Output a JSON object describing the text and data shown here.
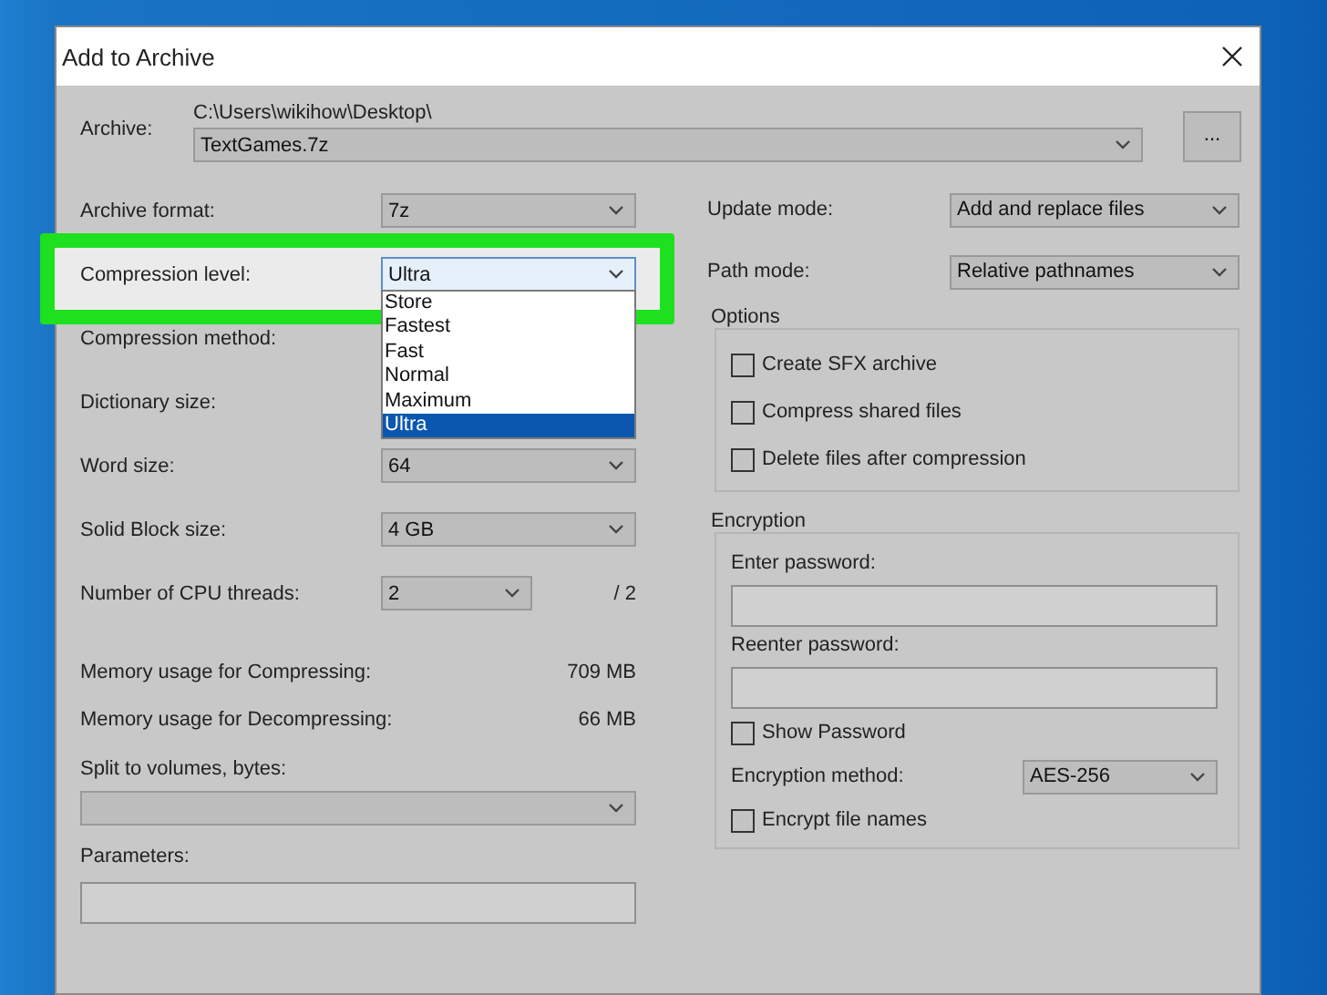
{
  "window": {
    "title": "Add to Archive"
  },
  "archive": {
    "label": "Archive:",
    "path": "C:\\Users\\wikihow\\Desktop\\",
    "value": "TextGames.7z",
    "browse_button": "..."
  },
  "left_rows": [
    {
      "kind": "combo",
      "label": "Archive format:",
      "value": "7z"
    },
    {
      "kind": "combo",
      "label": "Compression level:",
      "value": "Ultra",
      "highlighted": true,
      "expanded": true,
      "options": [
        {
          "label": "Store",
          "selected": false
        },
        {
          "label": "Fastest",
          "selected": false
        },
        {
          "label": "Fast",
          "selected": false
        },
        {
          "label": "Normal",
          "selected": false
        },
        {
          "label": "Maximum",
          "selected": false
        },
        {
          "label": "Ultra",
          "selected": true
        }
      ]
    },
    {
      "kind": "combo",
      "label": "Compression method:"
    },
    {
      "kind": "combo",
      "label": "Dictionary size:"
    },
    {
      "kind": "combo",
      "label": "Word size:",
      "value": "64"
    },
    {
      "kind": "combo",
      "label": "Solid Block size:",
      "value": "4 GB"
    },
    {
      "kind": "short_combo",
      "label": "Number of CPU threads:",
      "value": "2",
      "suffix": "/ 2"
    },
    {
      "kind": "reading",
      "label": "Memory usage for Compressing:",
      "value": "709 MB"
    },
    {
      "kind": "reading",
      "label": "Memory usage for Decompressing:",
      "value": "66 MB"
    },
    {
      "kind": "wide_combo",
      "label": "Split to volumes, bytes:"
    },
    {
      "kind": "wide_field",
      "label": "Parameters:"
    }
  ],
  "update_mode": {
    "label": "Update mode:",
    "value": "Add and replace files"
  },
  "path_mode": {
    "label": "Path mode:",
    "value": "Relative pathnames"
  },
  "options": {
    "title": "Options",
    "checkboxes": [
      {
        "label": "Create SFX archive",
        "checked": false
      },
      {
        "label": "Compress shared files",
        "checked": false
      },
      {
        "label": "Delete files after compression",
        "checked": false
      }
    ]
  },
  "encryption": {
    "title": "Encryption",
    "password_fields": [
      {
        "label": "Enter password:"
      },
      {
        "label": "Reenter password:"
      }
    ],
    "show_password": {
      "label": "Show Password",
      "checked": false
    },
    "method": {
      "label": "Encryption method:",
      "value": "AES-256"
    },
    "encrypt_names": {
      "label": "Encrypt file names",
      "checked": false
    }
  }
}
